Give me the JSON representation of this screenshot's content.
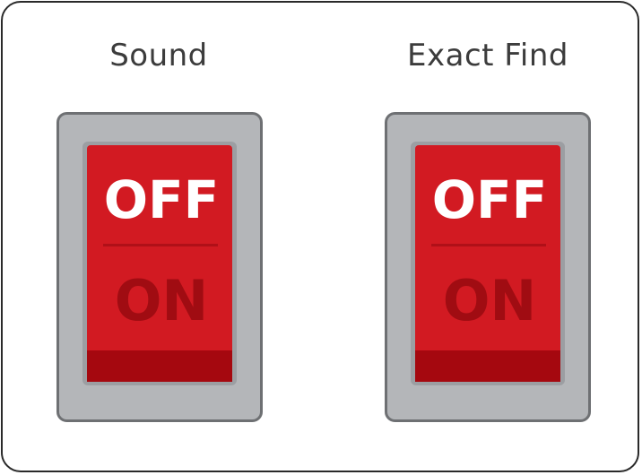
{
  "switches": [
    {
      "label": "Sound",
      "off_text": "OFF",
      "on_text": "ON",
      "state": "off"
    },
    {
      "label": "Exact Find",
      "off_text": "OFF",
      "on_text": "ON",
      "state": "off"
    }
  ],
  "colors": {
    "frame_border": "#2a2a2a",
    "housing": "#b4b6b9",
    "housing_border": "#6e7073",
    "rocker_red": "#d21a22",
    "rocker_dark": "#a5080f",
    "off_text": "#ffffff",
    "on_text": "#a00c12"
  }
}
